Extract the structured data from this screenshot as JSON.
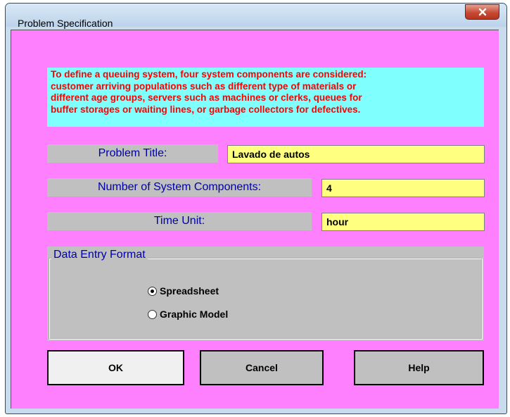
{
  "window": {
    "title": "Problem Specification",
    "close_icon": "close-icon"
  },
  "info": {
    "text": "To define a queuing system, four system components are considered:\ncustomer arriving populations such as different type of materials or\ndifferent age groups, servers such as machines or clerks, queues for\nbuffer storages or waiting lines, or garbage collectors for defectives."
  },
  "fields": {
    "problem_title": {
      "label": "Problem Title:",
      "value": "Lavado de autos"
    },
    "components": {
      "label": "Number of System Components:",
      "value": "4"
    },
    "time_unit": {
      "label": "Time Unit:",
      "value": "hour"
    }
  },
  "data_entry": {
    "legend": "Data Entry Format",
    "options": [
      {
        "label": "Spreadsheet",
        "selected": true
      },
      {
        "label": "Graphic Model",
        "selected": false
      }
    ]
  },
  "buttons": {
    "ok": "OK",
    "cancel": "Cancel",
    "help": "Help"
  },
  "colors": {
    "client_bg": "#ff80ff",
    "info_bg": "#80ffff",
    "info_text": "#ff0000",
    "label_text": "#0000a8",
    "field_bg": "#ffff80"
  }
}
